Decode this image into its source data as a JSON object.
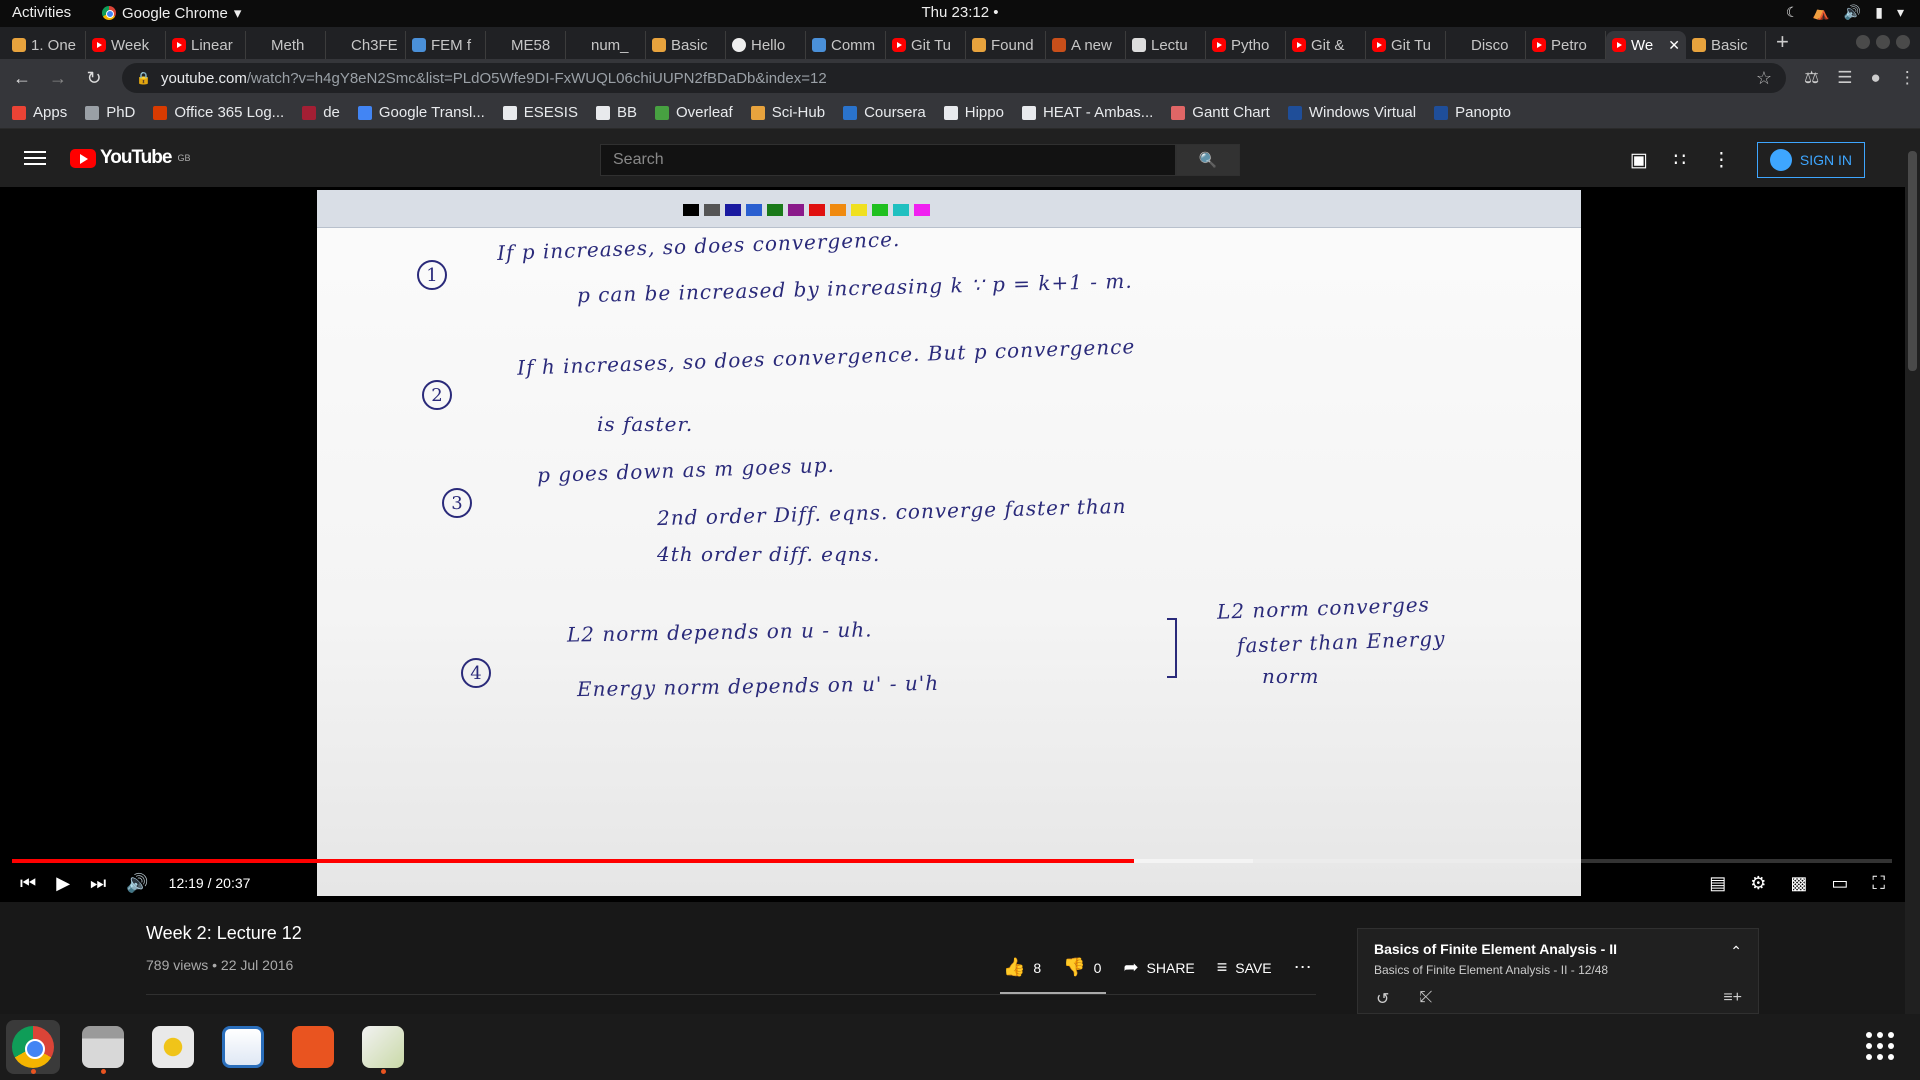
{
  "topbar": {
    "activities": "Activities",
    "app_name": "Google Chrome",
    "clock": "Thu 23:12"
  },
  "tabs": [
    {
      "label": "1. One",
      "icon": "book-icon"
    },
    {
      "label": "Week",
      "icon": "youtube-icon"
    },
    {
      "label": "Linear",
      "icon": "youtube-icon"
    },
    {
      "label": "Meth",
      "icon": "blank-icon"
    },
    {
      "label": "Ch3FE",
      "icon": "blank-icon"
    },
    {
      "label": "FEM f",
      "icon": "doc-icon"
    },
    {
      "label": "ME58",
      "icon": "blank-icon"
    },
    {
      "label": "num_",
      "icon": "blank-icon"
    },
    {
      "label": "Basic",
      "icon": "book-icon"
    },
    {
      "label": "Hello",
      "icon": "github-icon"
    },
    {
      "label": "Comm",
      "icon": "doc-icon"
    },
    {
      "label": "Git Tu",
      "icon": "youtube-icon"
    },
    {
      "label": "Found",
      "icon": "book-icon"
    },
    {
      "label": "A new",
      "icon": "orange-icon"
    },
    {
      "label": "Lectu",
      "icon": "calendar-icon"
    },
    {
      "label": "Pytho",
      "icon": "youtube-icon"
    },
    {
      "label": "Git &",
      "icon": "youtube-icon"
    },
    {
      "label": "Git Tu",
      "icon": "youtube-icon"
    },
    {
      "label": "Disco",
      "icon": "blank-icon"
    },
    {
      "label": "Petro",
      "icon": "youtube-icon"
    },
    {
      "label": "We",
      "icon": "youtube-icon",
      "active": true
    },
    {
      "label": "Basic",
      "icon": "book-icon"
    }
  ],
  "omnibox": {
    "host": "youtube.com",
    "path": "/watch?v=h4gY8eN2Smc&list=PLdO5Wfe9DI-FxWUQL06chiUUPN2fBDaDb&index=12"
  },
  "bookmarks": [
    {
      "label": "Apps",
      "icon": "apps-grid-icon",
      "color": "#ea4335"
    },
    {
      "label": "PhD",
      "icon": "folder-icon",
      "color": "#9aa0a6"
    },
    {
      "label": "Office 365 Log...",
      "icon": "office-icon",
      "color": "#d83b01"
    },
    {
      "label": "de",
      "icon": "mit-icon",
      "color": "#a31f34"
    },
    {
      "label": "Google Transl...",
      "icon": "translate-icon",
      "color": "#4285f4"
    },
    {
      "label": "ESESIS",
      "icon": "esesis-icon",
      "color": "#e8eaed"
    },
    {
      "label": "BB",
      "icon": "blackboard-icon",
      "color": "#e8eaed"
    },
    {
      "label": "Overleaf",
      "icon": "overleaf-icon",
      "color": "#47a141"
    },
    {
      "label": "Sci-Hub",
      "icon": "scihub-icon",
      "color": "#e8a33d"
    },
    {
      "label": "Coursera",
      "icon": "coursera-icon",
      "color": "#2a73cc"
    },
    {
      "label": "Hippo",
      "icon": "hippo-icon",
      "color": "#e8eaed"
    },
    {
      "label": "HEAT - Ambas...",
      "icon": "heat-icon",
      "color": "#e8eaed"
    },
    {
      "label": "Gantt Chart",
      "icon": "gantt-icon",
      "color": "#e06666"
    },
    {
      "label": "Windows Virtual",
      "icon": "windows-icon",
      "color": "#1f4e99"
    },
    {
      "label": "Panopto",
      "icon": "panopto-icon",
      "color": "#1f4e99"
    }
  ],
  "youtube": {
    "logo_text": "YouTube",
    "region": "GB",
    "search_placeholder": "Search",
    "sign_in": "SIGN IN"
  },
  "video": {
    "notes": {
      "n1": "1",
      "l1a": "If  p  increases,   so  does   convergence.",
      "l1b": "p can be increased  by  increasing   k   ∵   p = k+1 - m.",
      "n2": "2",
      "l2a": "If  h  increases,   so  does  convergence.    But  p  convergence",
      "l2b": "is  faster.",
      "n3": "3",
      "l3a": "p  goes  down   as   m  goes  up.",
      "l3b": "2nd  order   Diff.  eqns.   converge  faster  than",
      "l3c": "4th  order   diff.  eqns.",
      "n4": "4",
      "l4a": "L2  norm   depends   on     u - uh.",
      "l4b": "Energy   norm  depends   on    u' - u'h",
      "l4c": "L2  norm  converges",
      "l4d": "faster  than  Energy",
      "l4e": "norm"
    },
    "palette": [
      "#000000",
      "#555555",
      "#1a1aa0",
      "#2a5fd0",
      "#1a7a1a",
      "#8a1a8a",
      "#e01010",
      "#f08a10",
      "#f0e020",
      "#20c020",
      "#20c0c0",
      "#f020f0"
    ],
    "time_current": "12:19",
    "time_total": "20:37",
    "time_display": "12:19 / 20:37",
    "progress": 0.597,
    "buffered": 0.66
  },
  "details": {
    "title": "Week 2: Lecture 12",
    "meta": "789 views • 22 Jul 2016",
    "likes": "8",
    "dislikes": "0",
    "share": "SHARE",
    "save": "SAVE"
  },
  "playlist": {
    "title": "Basics of Finite Element Analysis - II",
    "subtitle_name": "Basics of Finite Element Analysis - II",
    "subtitle_pos": " - 12/48"
  }
}
